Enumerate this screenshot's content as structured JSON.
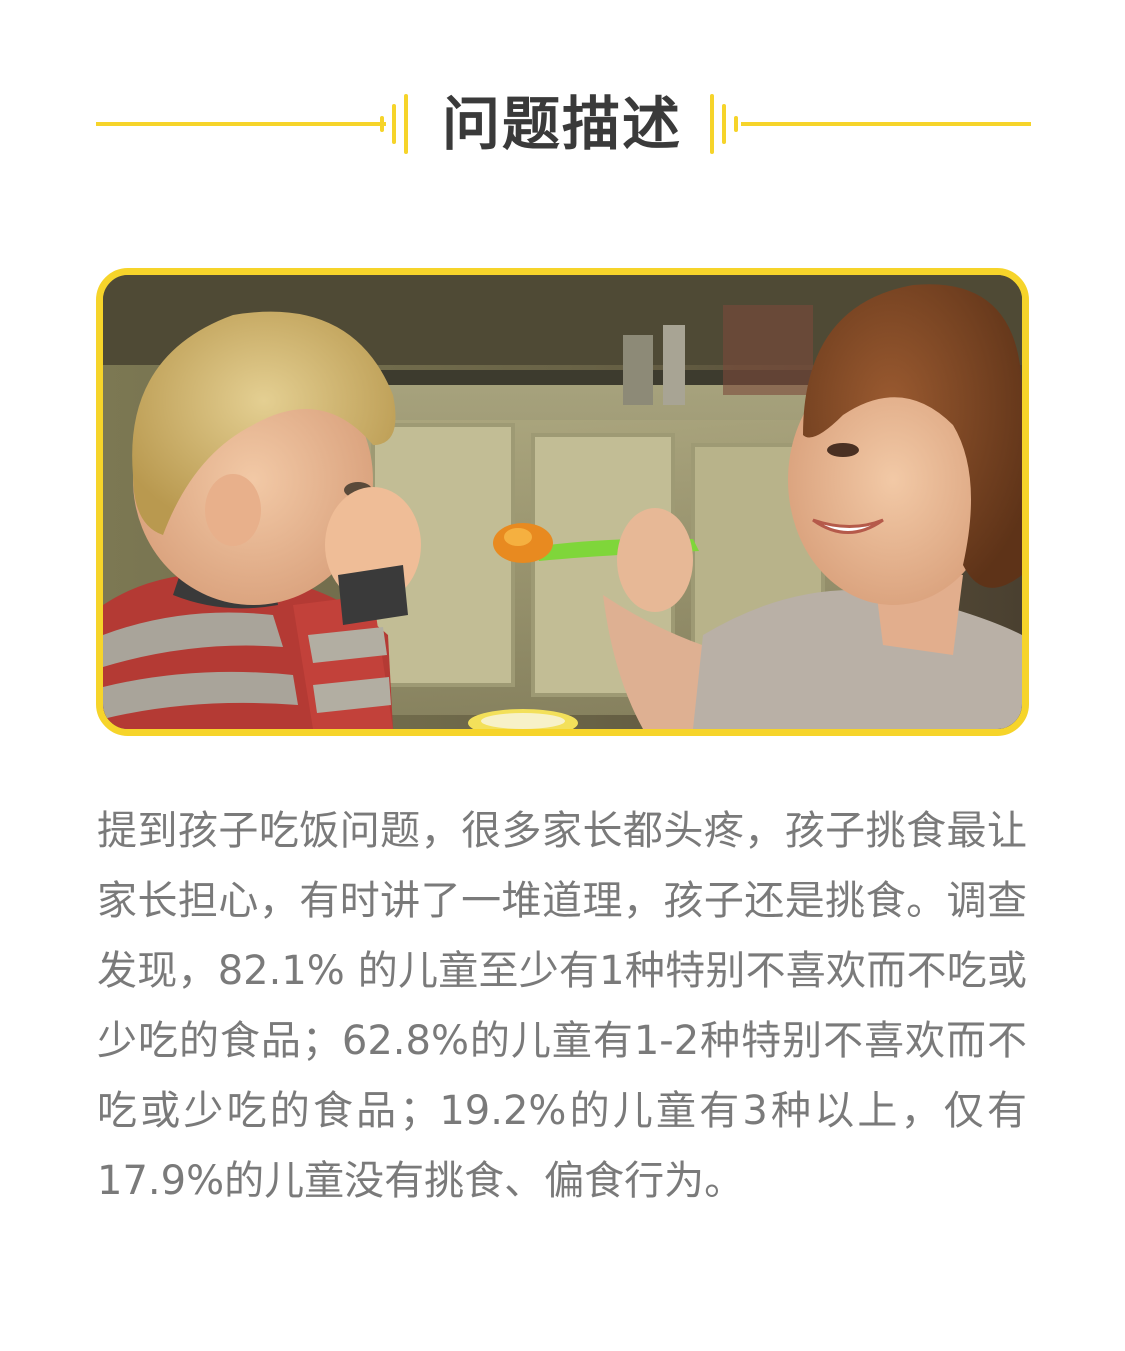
{
  "header": {
    "title": "问题描述",
    "accent_color": "#f6d42a"
  },
  "photo": {
    "icon": "photo-child-refusing-food"
  },
  "body": {
    "paragraph": "提到孩子吃饭问题，很多家长都头疼，孩子挑食最让家长担心，有时讲了一堆道理，孩子还是挑食。调查发现，82.1% 的儿童至少有1种特别不喜欢而不吃或少吃的食品；62.8%的儿童有1-2种特别不喜欢而不吃或少吃的食品；19.2%的儿童有3种以上，仅有17.9%的儿童没有挑食、偏食行为。"
  }
}
